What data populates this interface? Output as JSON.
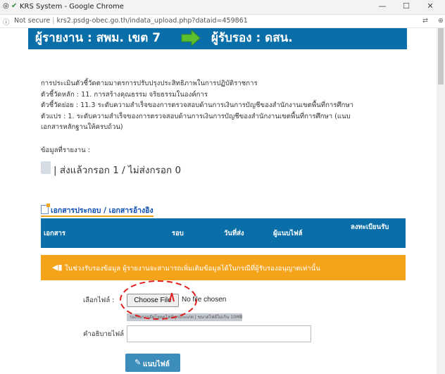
{
  "browser": {
    "tab_title": "KRS System - Google Chrome",
    "security_label": "Not secure",
    "url": "krs2.psdg-obec.go.th/indata_upload.php?dataid=459861"
  },
  "header": {
    "from": "ผู้รายงาน : สพม. เขต 7",
    "to": "ผู้รับรอง : ดสน."
  },
  "info": {
    "line1": "การประเมินตัวชี้วัดตามมาตรการปรับปรุงประสิทธิภาพในการปฏิบัติราชการ",
    "line2": "ตัวชี้วัดหลัก : 11. การสร้างคุณธรรม จริยธรรมในองค์การ",
    "line3": "ตัวชี้วัดย่อย : 11.3 ระดับความสำเร็จของการตรวจสอบด้านการเงินการบัญชีของสำนักงานเขตพื้นที่การศึกษา",
    "line4": "ตัวแปร : 1. ระดับความสำเร็จของการตรวจสอบด้านการเงินการบัญชีของสำนักงานเขตพื้นที่การศึกษา (แนบ",
    "line5": "เอกสารหลักฐานให้ครบถ้วน)"
  },
  "report": {
    "label": "ข้อมูลที่รายงาน :",
    "status": "| ส่งแล้วกรอก 1 / ไม่ส่งกรอก 0"
  },
  "docs": {
    "title": "เอกสารประกอบ / เอกสารอ้างอิง",
    "columns": [
      "เอกสาร",
      "รอบ",
      "วันที่ส่ง",
      "ผู้แนบไฟล์",
      "ลงทะเบียนรับ"
    ]
  },
  "alert": {
    "text": "ในช่วงรับรองข้อมูล ผู้รายงานจะสามารถเพิ่มเติมข้อมูลได้ในกรณีที่ผู้รับรองอนุญาตเท่านั้น"
  },
  "upload": {
    "file_label": "เลือกไฟล์ :",
    "choose_label": "Choose File",
    "no_file": "No file chosen",
    "hint": "รองรับการอัพโหลดไฟล์ทุกประเภท | ขนาดไฟล์ไม่เกิน 10MB",
    "desc_label": "คำอธิบายไฟล์ :",
    "desc_value": "",
    "button": "แนบไฟล์"
  },
  "colors": {
    "banner": "#0a6ea8",
    "alert": "#f4a31b",
    "button": "#3c8dbc",
    "annotation": "#e02020"
  }
}
